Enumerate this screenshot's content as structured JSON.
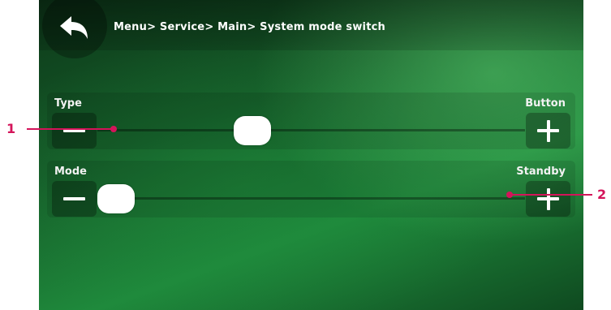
{
  "header": {
    "breadcrumb": "Menu> Service> Main> System mode switch",
    "back_icon": "back-arrow-icon"
  },
  "rows": [
    {
      "label": "Type",
      "value": "Button",
      "slider_fraction": 0.35
    },
    {
      "label": "Mode",
      "value": "Standby",
      "slider_fraction": 0.0
    }
  ],
  "callouts": [
    {
      "label": "1"
    },
    {
      "label": "2"
    }
  ],
  "colors": {
    "accent": "#d4145a",
    "background": "#1f8a3c"
  }
}
